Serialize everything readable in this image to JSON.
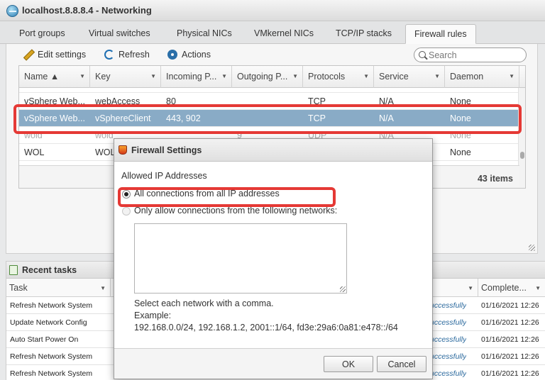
{
  "window": {
    "title": "localhost.8.8.8.4 - Networking"
  },
  "tabs": [
    {
      "label": "Port groups"
    },
    {
      "label": "Virtual switches"
    },
    {
      "label": "Physical NICs"
    },
    {
      "label": "VMkernel NICs"
    },
    {
      "label": "TCP/IP stacks"
    },
    {
      "label": "Firewall rules",
      "active": true
    }
  ],
  "toolbar": {
    "edit_settings": "Edit settings",
    "refresh": "Refresh",
    "actions": "Actions",
    "search_placeholder": "Search"
  },
  "grid": {
    "columns": [
      "Name ▲",
      "Key",
      "Incoming P...",
      "Outgoing P...",
      "Protocols",
      "Service",
      "Daemon"
    ],
    "rows": [
      {
        "name": "vSphere Web...",
        "key": "webAccess",
        "incoming": "80",
        "outgoing": "",
        "protocols": "TCP",
        "service": "N/A",
        "daemon": "None"
      },
      {
        "name": "vSphere Web...",
        "key": "vSphereClient",
        "incoming": "443, 902",
        "outgoing": "",
        "protocols": "TCP",
        "service": "N/A",
        "daemon": "None",
        "selected": true
      },
      {
        "name": "wold",
        "key": "wold",
        "incoming": "",
        "outgoing": "9",
        "protocols": "UDP",
        "service": "N/A",
        "daemon": "None"
      },
      {
        "name": "WOL",
        "key": "WOL",
        "incoming": "",
        "outgoing": "",
        "protocols": "",
        "service": "",
        "daemon": "None"
      }
    ],
    "item_count": "43 items"
  },
  "recent_tasks": {
    "title": "Recent tasks",
    "columns": [
      "Task",
      "",
      "Complete..."
    ],
    "rows": [
      {
        "task": "Refresh Network System",
        "status": "uccessfully",
        "completed": "01/16/2021 12:26"
      },
      {
        "task": "Update Network Config",
        "status": "uccessfully",
        "completed": "01/16/2021 12:26"
      },
      {
        "task": "Auto Start Power On",
        "status": "uccessfully",
        "completed": "01/16/2021 12:26"
      },
      {
        "task": "Refresh Network System",
        "status": "uccessfully",
        "completed": "01/16/2021 12:26"
      },
      {
        "task": "Refresh Network System",
        "status": "uccessfully",
        "completed": "01/16/2021 12:26"
      }
    ]
  },
  "dialog": {
    "title": "Firewall Settings",
    "section_label": "Allowed IP Addresses",
    "option_all": "All connections from all IP addresses",
    "option_only": "Only allow connections from the following networks:",
    "selected_option": "all",
    "hint": "Select each network with a comma.",
    "example_label": "Example:",
    "example_value": "192.168.0.0/24, 192.168.1.2, 2001::1/64, fd3e:29a6:0a81:e478::/64",
    "ok_label": "OK",
    "cancel_label": "Cancel"
  },
  "annotation_color": "#e53935"
}
